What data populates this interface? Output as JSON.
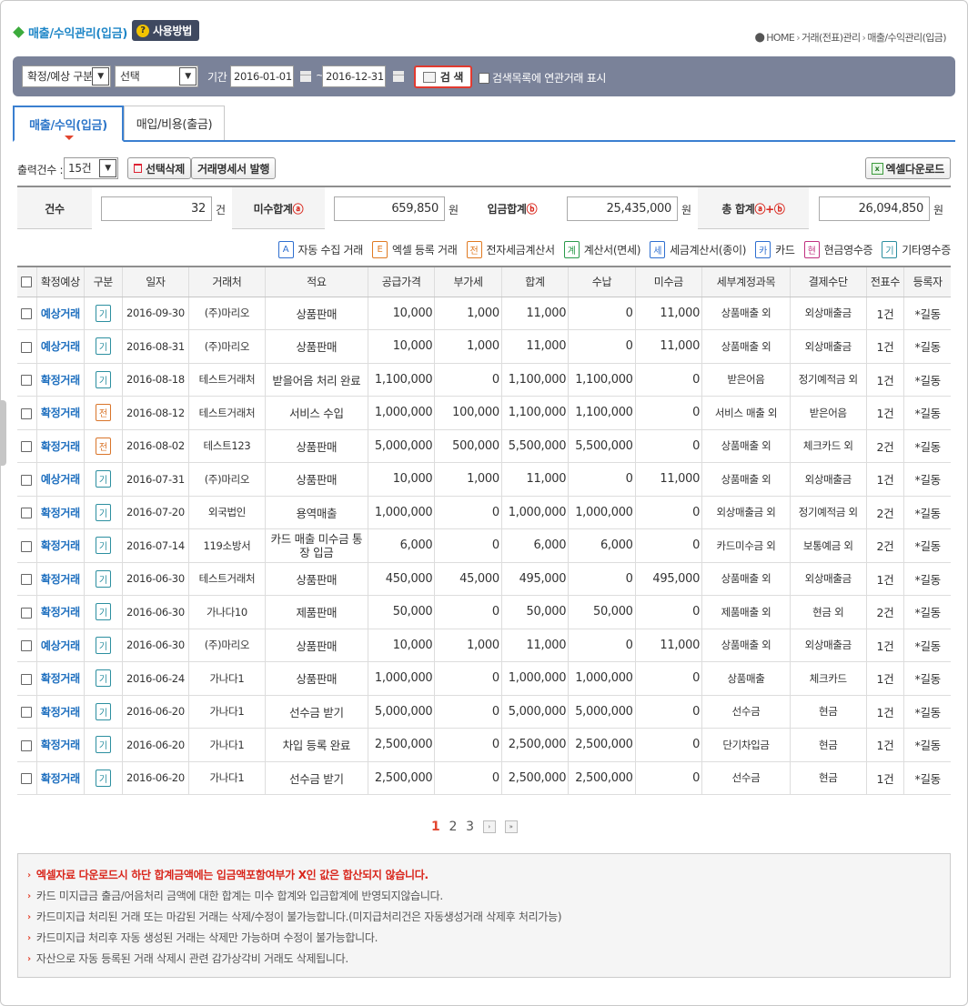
{
  "page": {
    "title": "매출/수익관리(입금)",
    "help_label": "사용방법",
    "breadcrumb": [
      "HOME",
      "거래(전표)관리",
      "매출/수익관리(입금)"
    ]
  },
  "search": {
    "type_select": "확정/예상 구분",
    "option_select": "선택",
    "period_label": "기간 :",
    "date_from": "2016-01-01",
    "date_sep": "~",
    "date_to": "2016-12-31",
    "search_button": "검 색",
    "related_checkbox_label": "검색목록에 연관거래 표시"
  },
  "tabs": [
    {
      "label": "매출/수익(입금)",
      "active": true
    },
    {
      "label": "매입/비용(출금)",
      "active": false
    }
  ],
  "toolbar": {
    "count_label": "출력건수 :",
    "count_value": "15건",
    "delete_button": "선택삭제",
    "statement_button": "거래명세서 발행",
    "excel_button": "엑셀다운로드"
  },
  "summary": {
    "count_label": "건수",
    "count_value": "32",
    "count_unit": "건",
    "unpaid_label": "미수합계",
    "unpaid_mark": "ⓐ",
    "unpaid_value": "659,850",
    "unpaid_unit": "원",
    "paid_label": "입금합계",
    "paid_mark": "ⓑ",
    "paid_value": "25,435,000",
    "paid_unit": "원",
    "total_label": "총 합계",
    "total_mark": "ⓐ+ⓑ",
    "total_value": "26,094,850",
    "total_unit": "원"
  },
  "legend": [
    {
      "icon": "A",
      "label": "자동 수집 거래",
      "color": "#2f6fd0"
    },
    {
      "icon": "E",
      "label": "엑셀 등록 거래",
      "color": "#e07a22"
    },
    {
      "icon": "전",
      "label": "전자세금계산서",
      "color": "#e07a22"
    },
    {
      "icon": "계",
      "label": "계산서(면세)",
      "color": "#2a9a4a"
    },
    {
      "icon": "세",
      "label": "세금계산서(종이)",
      "color": "#2f6fd0"
    },
    {
      "icon": "카",
      "label": "카드",
      "color": "#2f6fd0"
    },
    {
      "icon": "현",
      "label": "현금영수증",
      "color": "#c03080"
    },
    {
      "icon": "기",
      "label": "기타영수증",
      "color": "#2c8fa0"
    }
  ],
  "table": {
    "headers": [
      "확정예상",
      "구분",
      "일자",
      "거래처",
      "적요",
      "공급가격",
      "부가세",
      "합계",
      "수납",
      "미수금",
      "세부계정과목",
      "결제수단",
      "전표수",
      "등록자"
    ],
    "rows": [
      [
        "예상거래",
        "기",
        "2016-09-30",
        "(주)마리오",
        "상품판매",
        "10,000",
        "1,000",
        "11,000",
        "0",
        "11,000",
        "상품매출 외",
        "외상매출금",
        "1건",
        "*길동"
      ],
      [
        "예상거래",
        "기",
        "2016-08-31",
        "(주)마리오",
        "상품판매",
        "10,000",
        "1,000",
        "11,000",
        "0",
        "11,000",
        "상품매출 외",
        "외상매출금",
        "1건",
        "*길동"
      ],
      [
        "확정거래",
        "기",
        "2016-08-18",
        "테스트거래처",
        "받을어음 처리 완료",
        "1,100,000",
        "0",
        "1,100,000",
        "1,100,000",
        "0",
        "받은어음",
        "정기예적금 외",
        "1건",
        "*길동"
      ],
      [
        "확정거래",
        "전",
        "2016-08-12",
        "테스트거래처",
        "서비스 수입",
        "1,000,000",
        "100,000",
        "1,100,000",
        "1,100,000",
        "0",
        "서비스 매출 외",
        "받은어음",
        "1건",
        "*길동"
      ],
      [
        "확정거래",
        "전",
        "2016-08-02",
        "테스트123",
        "상품판매",
        "5,000,000",
        "500,000",
        "5,500,000",
        "5,500,000",
        "0",
        "상품매출 외",
        "체크카드 외",
        "2건",
        "*길동"
      ],
      [
        "예상거래",
        "기",
        "2016-07-31",
        "(주)마리오",
        "상품판매",
        "10,000",
        "1,000",
        "11,000",
        "0",
        "11,000",
        "상품매출 외",
        "외상매출금",
        "1건",
        "*길동"
      ],
      [
        "확정거래",
        "기",
        "2016-07-20",
        "외국법인",
        "용역매출",
        "1,000,000",
        "0",
        "1,000,000",
        "1,000,000",
        "0",
        "외상매출금 외",
        "정기예적금 외",
        "2건",
        "*길동"
      ],
      [
        "확정거래",
        "기",
        "2016-07-14",
        "119소방서",
        "카드 매출 미수금 통장 입금",
        "6,000",
        "0",
        "6,000",
        "6,000",
        "0",
        "카드미수금 외",
        "보통예금 외",
        "2건",
        "*길동"
      ],
      [
        "확정거래",
        "기",
        "2016-06-30",
        "테스트거래처",
        "상품판매",
        "450,000",
        "45,000",
        "495,000",
        "0",
        "495,000",
        "상품매출 외",
        "외상매출금",
        "1건",
        "*길동"
      ],
      [
        "확정거래",
        "기",
        "2016-06-30",
        "가나다10",
        "제품판매",
        "50,000",
        "0",
        "50,000",
        "50,000",
        "0",
        "제품매출 외",
        "현금 외",
        "2건",
        "*길동"
      ],
      [
        "예상거래",
        "기",
        "2016-06-30",
        "(주)마리오",
        "상품판매",
        "10,000",
        "1,000",
        "11,000",
        "0",
        "11,000",
        "상품매출 외",
        "외상매출금",
        "1건",
        "*길동"
      ],
      [
        "확정거래",
        "기",
        "2016-06-24",
        "가나다1",
        "상품판매",
        "1,000,000",
        "0",
        "1,000,000",
        "1,000,000",
        "0",
        "상품매출",
        "체크카드",
        "1건",
        "*길동"
      ],
      [
        "확정거래",
        "기",
        "2016-06-20",
        "가나다1",
        "선수금 받기",
        "5,000,000",
        "0",
        "5,000,000",
        "5,000,000",
        "0",
        "선수금",
        "현금",
        "1건",
        "*길동"
      ],
      [
        "확정거래",
        "기",
        "2016-06-20",
        "가나다1",
        "차입 등록 완료",
        "2,500,000",
        "0",
        "2,500,000",
        "2,500,000",
        "0",
        "단기차입금",
        "현금",
        "1건",
        "*길동"
      ],
      [
        "확정거래",
        "기",
        "2016-06-20",
        "가나다1",
        "선수금 받기",
        "2,500,000",
        "0",
        "2,500,000",
        "2,500,000",
        "0",
        "선수금",
        "현금",
        "1건",
        "*길동"
      ]
    ]
  },
  "pagination": {
    "pages": [
      "1",
      "2",
      "3"
    ],
    "current": "1",
    "next": "›",
    "last": "»"
  },
  "notes": [
    {
      "text": "엑셀자료 다운로드시 하단 합계금액에는 입금액포함여부가 X인 값은 합산되지 않습니다.",
      "strong": true
    },
    {
      "text": "카드 미지급금 출금/어음처리 금액에 대한 합계는 미수 합계와 입금합계에 반영되지않습니다.",
      "strong": false
    },
    {
      "text": "카드미지급 처리된 거래 또는 마감된 거래는 삭제/수정이 불가능합니다.(미지급처리건은 자동생성거래 삭제후 처리가능)",
      "strong": false
    },
    {
      "text": "카드미지급 처리후 자동 생성된 거래는 삭제만 가능하며 수정이 불가능합니다.",
      "strong": false
    },
    {
      "text": "자산으로 자동 등록된 거래 삭제시 관련 감가상각비 거래도 삭제됩니다.",
      "strong": false
    }
  ]
}
